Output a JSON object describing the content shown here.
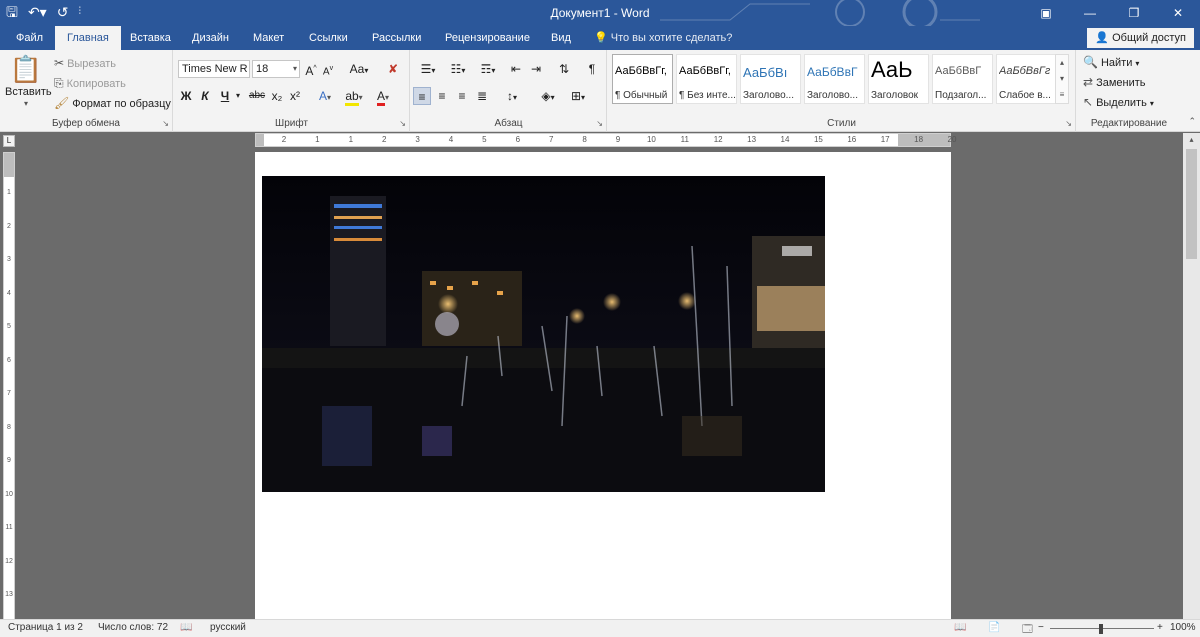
{
  "app": {
    "title": "Документ1 - Word"
  },
  "qat": {
    "save_icon": "save-icon",
    "undo_icon": "undo-icon",
    "redo_icon": "redo-icon",
    "customize_icon": "customize-qat-icon"
  },
  "tabs": [
    {
      "label": "Файл"
    },
    {
      "label": "Главная"
    },
    {
      "label": "Вставка"
    },
    {
      "label": "Дизайн"
    },
    {
      "label": "Макет"
    },
    {
      "label": "Ссылки"
    },
    {
      "label": "Рассылки"
    },
    {
      "label": "Рецензирование"
    },
    {
      "label": "Вид"
    }
  ],
  "active_tab": "Главная",
  "tell_me": {
    "placeholder": "Что вы хотите сделать?"
  },
  "share": {
    "label": "Общий доступ"
  },
  "clipboard": {
    "label": "Буфер обмена",
    "paste": "Вставить",
    "cut": "Вырезать",
    "copy": "Копировать",
    "format_painter": "Формат по образцу"
  },
  "font": {
    "label": "Шрифт",
    "font_name": "Times New R",
    "font_size": "18",
    "bold": "Ж",
    "italic": "К",
    "underline": "Ч",
    "strike": "abc",
    "subscript": "x₂",
    "superscript": "x²",
    "case": "Aa"
  },
  "paragraph": {
    "label": "Абзац"
  },
  "styles": {
    "label": "Стили",
    "items": [
      {
        "preview": "АаБбВвГг,",
        "name": "¶ Обычный"
      },
      {
        "preview": "АаБбВвГг,",
        "name": "¶ Без инте..."
      },
      {
        "preview": "АаБбВı",
        "name": "Заголово..."
      },
      {
        "preview": "АаБбВвГ",
        "name": "Заголово..."
      },
      {
        "preview": "АаЬ",
        "name": "Заголовок"
      },
      {
        "preview": "АаБбВвГ",
        "name": "Подзагол..."
      },
      {
        "preview": "АаБбВвГг",
        "name": "Слабое в..."
      }
    ]
  },
  "editing": {
    "label": "Редактирование",
    "find": "Найти",
    "replace": "Заменить",
    "select": "Выделить"
  },
  "ruler": {
    "h_numbers": [
      "2",
      "1",
      "1",
      "2",
      "3",
      "4",
      "5",
      "6",
      "7",
      "8",
      "9",
      "10",
      "11",
      "12",
      "13",
      "14",
      "15",
      "16",
      "17",
      "18",
      "20"
    ],
    "v_numbers": [
      "1",
      "2",
      "3",
      "4",
      "5",
      "6",
      "7",
      "8",
      "9",
      "10",
      "11",
      "12",
      "13"
    ]
  },
  "status": {
    "page": "Страница 1 из 2",
    "words": "Число слов: 72",
    "language": "русский",
    "zoom": "100%"
  }
}
